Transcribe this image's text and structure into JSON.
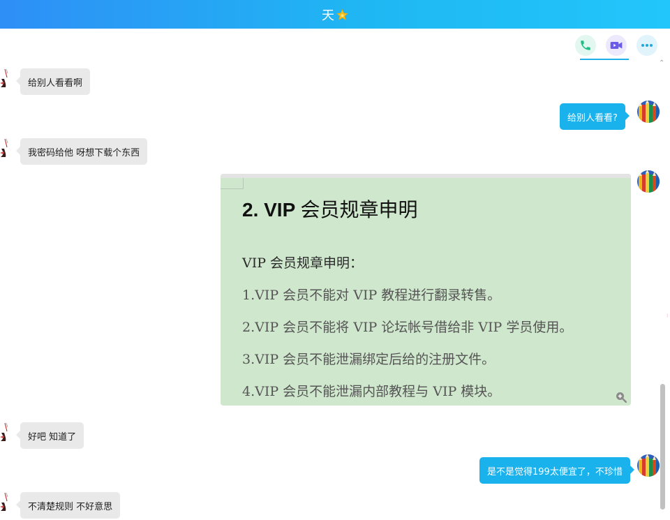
{
  "header": {
    "title": "天",
    "badge_icon": "star-icon"
  },
  "toolbar": {
    "phone_icon": "phone-icon",
    "video_icon": "video-camera-icon",
    "more_icon": "more-dots-icon"
  },
  "messages": [
    {
      "side": "in",
      "text": "给别人看看啊"
    },
    {
      "side": "out",
      "text": "给别人看看?"
    },
    {
      "side": "in",
      "text": "我密码给他 呀想下载个东西"
    },
    {
      "side": "in",
      "text": "好吧 知道了"
    },
    {
      "side": "out",
      "text": "是不是觉得199太便宜了，不珍惜"
    },
    {
      "side": "in",
      "text": "不清楚规则  不好意思"
    }
  ],
  "image_message": {
    "title_prefix": "2. VIP ",
    "title_cn": "会员规章申明",
    "heading": "VIP 会员规章申明：",
    "rules": [
      "1.VIP 会员不能对 VIP 教程进行翻录转售。",
      "2.VIP 会员不能将 VIP 论坛帐号借给非 VIP 学员使用。",
      "3.VIP 会员不能泄漏绑定后给的注册文件。",
      "4.VIP 会员不能泄漏内部教程与 VIP 模块。"
    ],
    "zoom_icon": "zoom-in-icon"
  },
  "colors": {
    "header_start": "#2e8ff6",
    "header_end": "#22c6fb",
    "outgoing_bubble": "#1ab2ec",
    "incoming_bubble": "#e9e9e9",
    "image_bg": "#cfe7cc"
  }
}
